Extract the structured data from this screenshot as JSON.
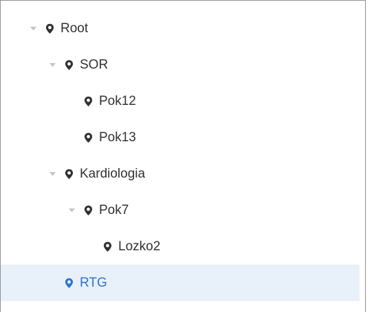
{
  "tree": {
    "nodes": [
      {
        "label": "Root",
        "depth": 0,
        "expanded": true,
        "has_children": true,
        "selected": false
      },
      {
        "label": "SOR",
        "depth": 1,
        "expanded": true,
        "has_children": true,
        "selected": false
      },
      {
        "label": "Pok12",
        "depth": 2,
        "expanded": false,
        "has_children": false,
        "selected": false
      },
      {
        "label": "Pok13",
        "depth": 2,
        "expanded": false,
        "has_children": false,
        "selected": false
      },
      {
        "label": "Kardiologia",
        "depth": 1,
        "expanded": true,
        "has_children": true,
        "selected": false
      },
      {
        "label": "Pok7",
        "depth": 2,
        "expanded": true,
        "has_children": true,
        "selected": false
      },
      {
        "label": "Lozko2",
        "depth": 3,
        "expanded": false,
        "has_children": false,
        "selected": false
      },
      {
        "label": "RTG",
        "depth": 1,
        "expanded": false,
        "has_children": false,
        "selected": true
      }
    ],
    "icons": {
      "caret": "caret-down-icon",
      "node": "location-pin-icon"
    },
    "colors": {
      "text": "#303133",
      "selected_text": "#2f74d0",
      "selected_bg": "#e8f0f9",
      "caret": "#c0c4cc",
      "pin": "#303133",
      "selected_pin": "#2f74d0"
    }
  }
}
